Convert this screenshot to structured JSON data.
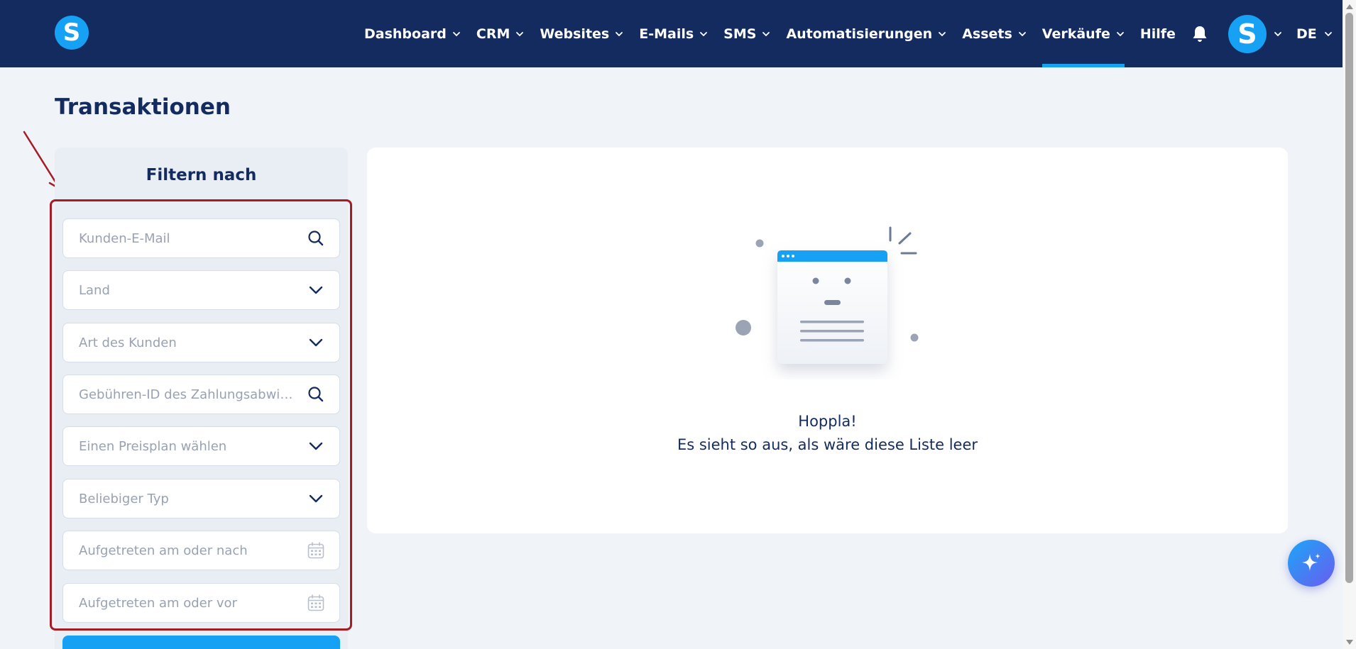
{
  "header": {
    "logo_letter": "S",
    "nav": [
      {
        "label": "Dashboard",
        "has_dropdown": true
      },
      {
        "label": "CRM",
        "has_dropdown": true
      },
      {
        "label": "Websites",
        "has_dropdown": true
      },
      {
        "label": "E-Mails",
        "has_dropdown": true
      },
      {
        "label": "SMS",
        "has_dropdown": true
      },
      {
        "label": "Automatisierungen",
        "has_dropdown": true
      },
      {
        "label": "Assets",
        "has_dropdown": true
      },
      {
        "label": "Verkäufe",
        "has_dropdown": true,
        "active": true
      },
      {
        "label": "Hilfe",
        "has_dropdown": false
      }
    ],
    "bell_icon": "bell-icon",
    "avatar_letter": "S",
    "language": "DE"
  },
  "page": {
    "title": "Transaktionen"
  },
  "filters": {
    "title": "Filtern nach",
    "customer_email": {
      "placeholder": "Kunden-E-Mail",
      "icon": "search-icon"
    },
    "country": {
      "placeholder": "Land",
      "icon": "chevron-down-icon"
    },
    "customer_type": {
      "placeholder": "Art des Kunden",
      "icon": "chevron-down-icon"
    },
    "charge_id": {
      "placeholder": "Gebühren-ID des Zahlungsabwicklers",
      "icon": "search-icon"
    },
    "price_plan": {
      "placeholder": "Einen Preisplan wählen",
      "icon": "chevron-down-icon"
    },
    "type": {
      "placeholder": "Beliebiger Typ",
      "icon": "chevron-down-icon"
    },
    "date_from": {
      "placeholder": "Aufgetreten am oder nach",
      "icon": "calendar-icon"
    },
    "date_to": {
      "placeholder": "Aufgetreten am oder vor",
      "icon": "calendar-icon"
    }
  },
  "empty_state": {
    "title": "Hoppla!",
    "message": "Es sieht so aus, als wäre diese Liste leer"
  },
  "colors": {
    "nav_bg": "#132b5e",
    "accent": "#17a1f5",
    "page_bg": "#f0f3f8",
    "highlight": "#a51d24"
  }
}
